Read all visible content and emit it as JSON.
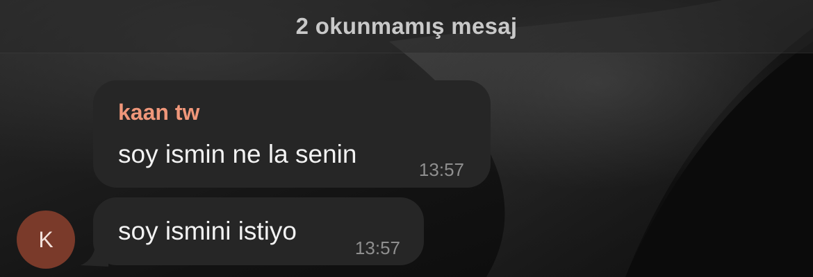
{
  "unread_banner": {
    "text": "2 okunmamış mesaj"
  },
  "messages": [
    {
      "sender": "kaan tw",
      "text": "soy ismin ne la senin",
      "time": "13:57"
    },
    {
      "text": "soy ismini istiyo",
      "time": "13:57"
    }
  ],
  "avatar": {
    "initial": "K",
    "color": "#7a3a2a"
  },
  "colors": {
    "sender_name": "#f0977a",
    "bubble": "#262626",
    "timestamp": "#8f8f8f"
  }
}
